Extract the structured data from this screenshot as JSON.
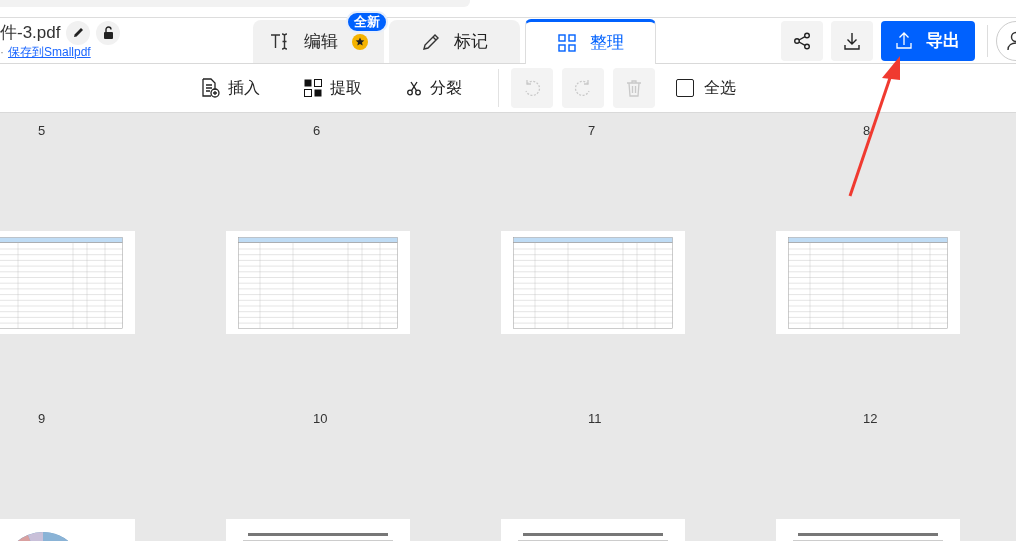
{
  "file": {
    "name": "件-3.pdf",
    "meta": "·",
    "save_link": "保存到Smallpdf"
  },
  "tabs": [
    {
      "label": "编辑",
      "selected": false,
      "badge": "全新",
      "starred": true
    },
    {
      "label": "标记",
      "selected": false,
      "starred": false
    },
    {
      "label": "整理",
      "selected": true,
      "starred": false
    }
  ],
  "export_button": "导出",
  "toolbar": [
    {
      "kind": "insert",
      "label": "插入"
    },
    {
      "kind": "extract",
      "label": "提取"
    },
    {
      "kind": "split",
      "label": "分裂"
    }
  ],
  "history": [
    {
      "kind": "undo",
      "disabled": true
    },
    {
      "kind": "redo",
      "disabled": true
    },
    {
      "kind": "delete",
      "disabled": true
    }
  ],
  "select_all": {
    "label": "全选",
    "checked": false
  },
  "pages": [
    {
      "number": "5",
      "kind": "table"
    },
    {
      "number": "6",
      "kind": "table"
    },
    {
      "number": "7",
      "kind": "table"
    },
    {
      "number": "8",
      "kind": "table"
    },
    {
      "number": "9",
      "kind": "chart"
    },
    {
      "number": "10",
      "kind": "text"
    },
    {
      "number": "11",
      "kind": "text"
    },
    {
      "number": "12",
      "kind": "text"
    }
  ]
}
